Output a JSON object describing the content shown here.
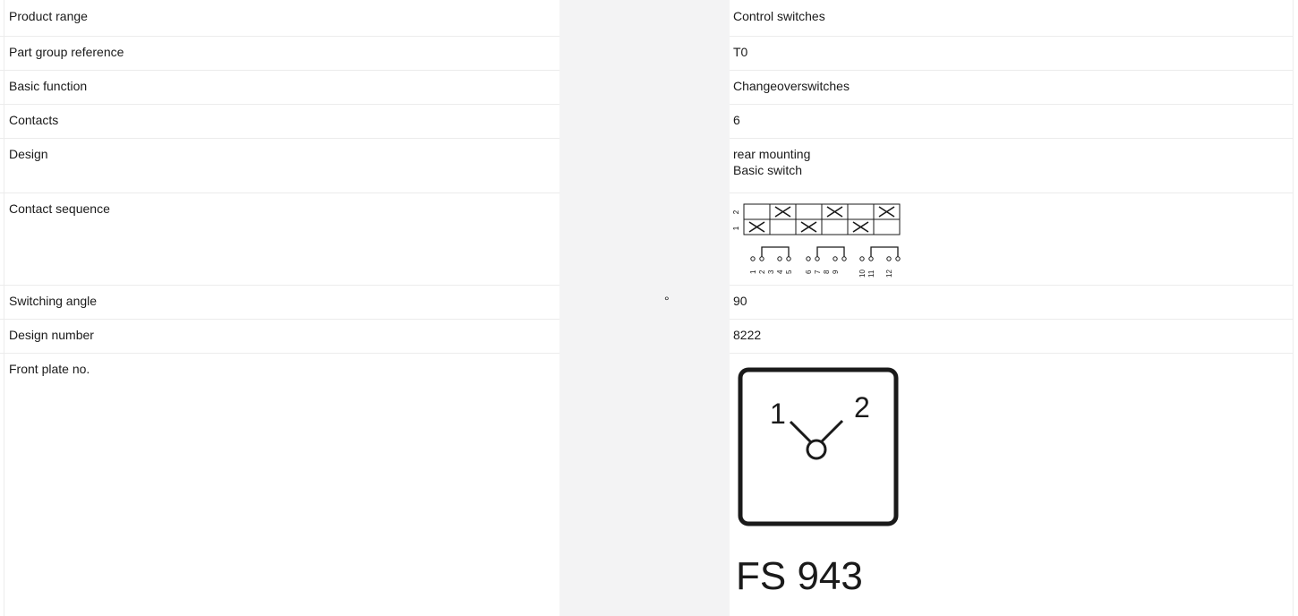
{
  "rows": [
    {
      "label": "Product range",
      "unit": "",
      "value": "Control switches"
    },
    {
      "label": "Part group reference",
      "unit": "",
      "value": "T0"
    },
    {
      "label": "Basic function",
      "unit": "",
      "value": "Changeoverswitches"
    },
    {
      "label": "Contacts",
      "unit": "",
      "value": "6"
    },
    {
      "label": "Design",
      "unit": "",
      "value_lines": [
        "rear mounting",
        "Basic switch"
      ]
    },
    {
      "label": "Contact sequence",
      "unit": "",
      "diagram": {
        "positions": [
          "1",
          "2"
        ],
        "position_2_closed_columns": [
          2,
          4,
          6
        ],
        "position_1_closed_columns": [
          1,
          3,
          5
        ],
        "terminals": [
          "1",
          "2",
          "3",
          "4",
          "5",
          "6",
          "7",
          "8",
          "9",
          "10",
          "11",
          "12"
        ]
      }
    },
    {
      "label": "Switching angle",
      "unit": "°",
      "value": "90"
    },
    {
      "label": "Design number",
      "unit": "",
      "value": "8222"
    },
    {
      "label": "Front plate no.",
      "unit": "",
      "front_plate": {
        "position_left": "1",
        "position_right": "2",
        "code": "FS 943"
      }
    }
  ]
}
